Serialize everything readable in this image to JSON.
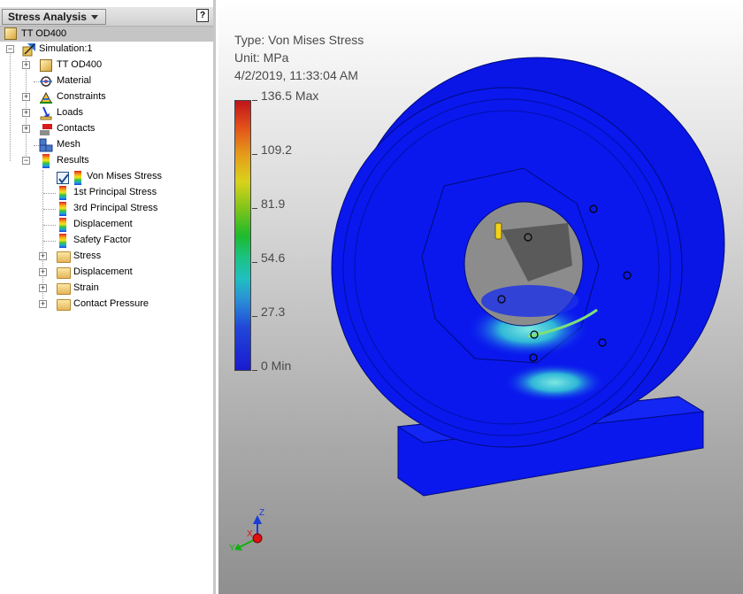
{
  "panel": {
    "title": "Stress Analysis",
    "help_label": "?",
    "document": "TT OD400",
    "tree": {
      "simulation": "Simulation:1",
      "part": "TT OD400",
      "material": "Material",
      "constraints": "Constraints",
      "loads": "Loads",
      "contacts": "Contacts",
      "mesh": "Mesh",
      "results": "Results",
      "result_items": [
        "Von Mises Stress",
        "1st Principal Stress",
        "3rd Principal Stress",
        "Displacement",
        "Safety Factor"
      ],
      "result_folders": [
        "Stress",
        "Displacement",
        "Strain",
        "Contact Pressure"
      ]
    }
  },
  "legend": {
    "type_line": "Type: Von Mises Stress",
    "unit_line": "Unit: MPa",
    "date_line": "4/2/2019, 11:33:04 AM",
    "max_label": "136.5 Max",
    "ticks": [
      "109.2",
      "81.9",
      "54.6",
      "27.3"
    ],
    "min_label": "0 Min",
    "scale": {
      "max": 136.5,
      "min": 0
    }
  },
  "triad": {
    "x": "X",
    "y": "Y",
    "z": "Z"
  },
  "colors": {
    "model_blue": "#0a18ee",
    "accent_green": "#1dbb2b",
    "axis_x": "#e01010",
    "axis_y": "#10b010",
    "axis_z": "#1a3cd8"
  }
}
